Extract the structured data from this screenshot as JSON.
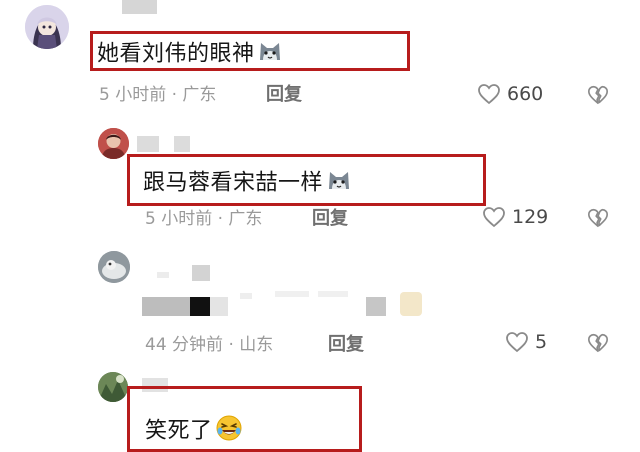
{
  "comments": [
    {
      "text": "她看刘伟的眼神",
      "emoji": "cat-face-emoji",
      "time": "5 小时前 · 广东",
      "reply_label": "回复",
      "likes": "660"
    },
    {
      "text": "跟马蓉看宋喆一样",
      "emoji": "cat-face-emoji",
      "time": "5 小时前 · 广东",
      "reply_label": "回复",
      "likes": "129"
    },
    {
      "text": "",
      "time": "44 分钟前 · 山东",
      "reply_label": "回复",
      "likes": "5"
    },
    {
      "text": "笑死了",
      "emoji": "rofl-emoji"
    }
  ],
  "colors": {
    "highlight_box": "#b71c1c",
    "meta_text": "#9a9a9a",
    "icon_stroke": "#888888"
  }
}
